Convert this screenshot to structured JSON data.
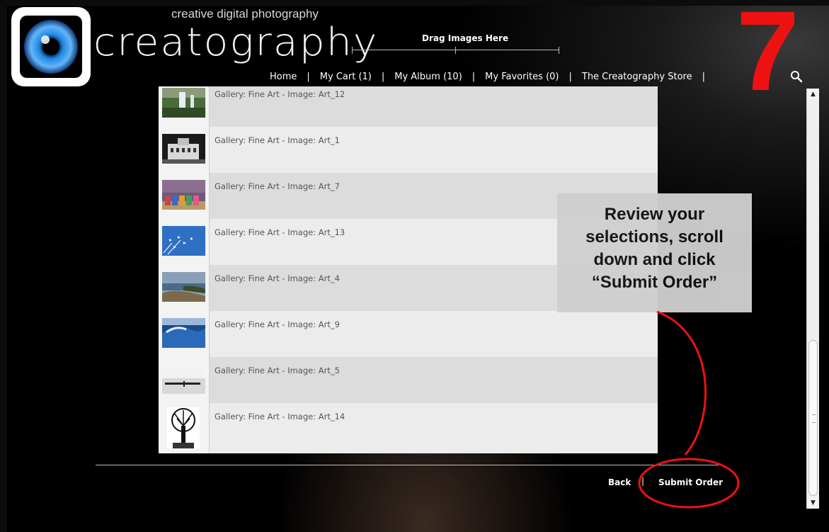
{
  "brand": {
    "tagline": "creative digital photography",
    "wordmark": "creatography",
    "drag_label": "Drag Images Here"
  },
  "nav": {
    "items": [
      "Home",
      "My Cart (1)",
      "My Album (10)",
      "My Favorites (0)",
      "The Creatography Store"
    ],
    "separator": "|"
  },
  "step_number": "7",
  "list": {
    "items": [
      {
        "label": "Gallery: Fine Art - Image: Art_12"
      },
      {
        "label": "Gallery: Fine Art - Image: Art_1"
      },
      {
        "label": "Gallery: Fine Art - Image: Art_7"
      },
      {
        "label": "Gallery: Fine Art - Image: Art_13"
      },
      {
        "label": "Gallery: Fine Art - Image: Art_4"
      },
      {
        "label": "Gallery: Fine Art - Image: Art_9"
      },
      {
        "label": "Gallery: Fine Art - Image: Art_5"
      },
      {
        "label": "Gallery: Fine Art - Image: Art_14"
      }
    ]
  },
  "callout": {
    "line1": "Review your",
    "line2": "selections, scroll",
    "line3": "down and click",
    "line4": "“Submit Order”"
  },
  "footer": {
    "back_label": "Back",
    "separator": "|",
    "submit_label": "Submit Order"
  },
  "colors": {
    "accent_red": "#ee1111",
    "logo_blue": "#1e88e5"
  }
}
